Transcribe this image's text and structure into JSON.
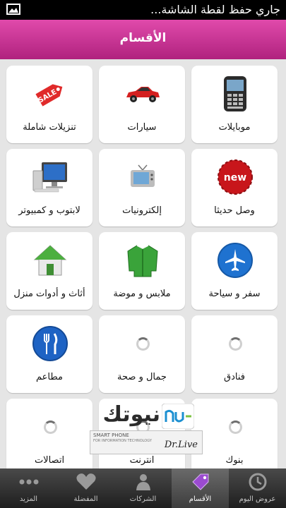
{
  "status_bar": {
    "text": "جاري حفظ لقطة الشاشة..."
  },
  "header": {
    "title": "الأقسام"
  },
  "categories": [
    {
      "label": "موبايلات",
      "icon": "phone-icon"
    },
    {
      "label": "سيارات",
      "icon": "car-icon"
    },
    {
      "label": "تنزيلات شاملة",
      "icon": "sale-tag-icon"
    },
    {
      "label": "وصل حديثا",
      "icon": "new-badge-icon"
    },
    {
      "label": "إلكترونيات",
      "icon": "tv-icon"
    },
    {
      "label": "لابتوب و كمبيوتر",
      "icon": "computer-icon"
    },
    {
      "label": "سفر و سياحة",
      "icon": "airplane-icon"
    },
    {
      "label": "ملابس و موضة",
      "icon": "jacket-icon"
    },
    {
      "label": "أثاث و أدوات منزل",
      "icon": "house-icon"
    },
    {
      "label": "فنادق",
      "icon": "loading-icon"
    },
    {
      "label": "جمال و صحة",
      "icon": "loading-icon"
    },
    {
      "label": "مطاعم",
      "icon": "fork-knife-icon"
    },
    {
      "label": "بنوك",
      "icon": "loading-icon"
    },
    {
      "label": "انترنت",
      "icon": "loading-icon"
    },
    {
      "label": "اتصالات",
      "icon": "loading-icon"
    }
  ],
  "watermark": {
    "brand": "نيوتك",
    "tagline_line1": "SMART PHONE",
    "tagline_line2": "FOR INFORMATION TECHNOLOGY",
    "signature": "Dr.Live"
  },
  "tabbar": [
    {
      "label": "عروض اليوم",
      "icon": "clock-icon",
      "active": false
    },
    {
      "label": "الأقسام",
      "icon": "tag-icon",
      "active": true
    },
    {
      "label": "الشركات",
      "icon": "person-icon",
      "active": false
    },
    {
      "label": "المفضلة",
      "icon": "heart-icon",
      "active": false
    },
    {
      "label": "المزيد",
      "icon": "more-dots-icon",
      "active": false
    }
  ],
  "colors": {
    "header_start": "#e04aab",
    "header_end": "#b0227e",
    "grid_background": "#e5e5e5",
    "tabbar": "#2a2a2a"
  }
}
